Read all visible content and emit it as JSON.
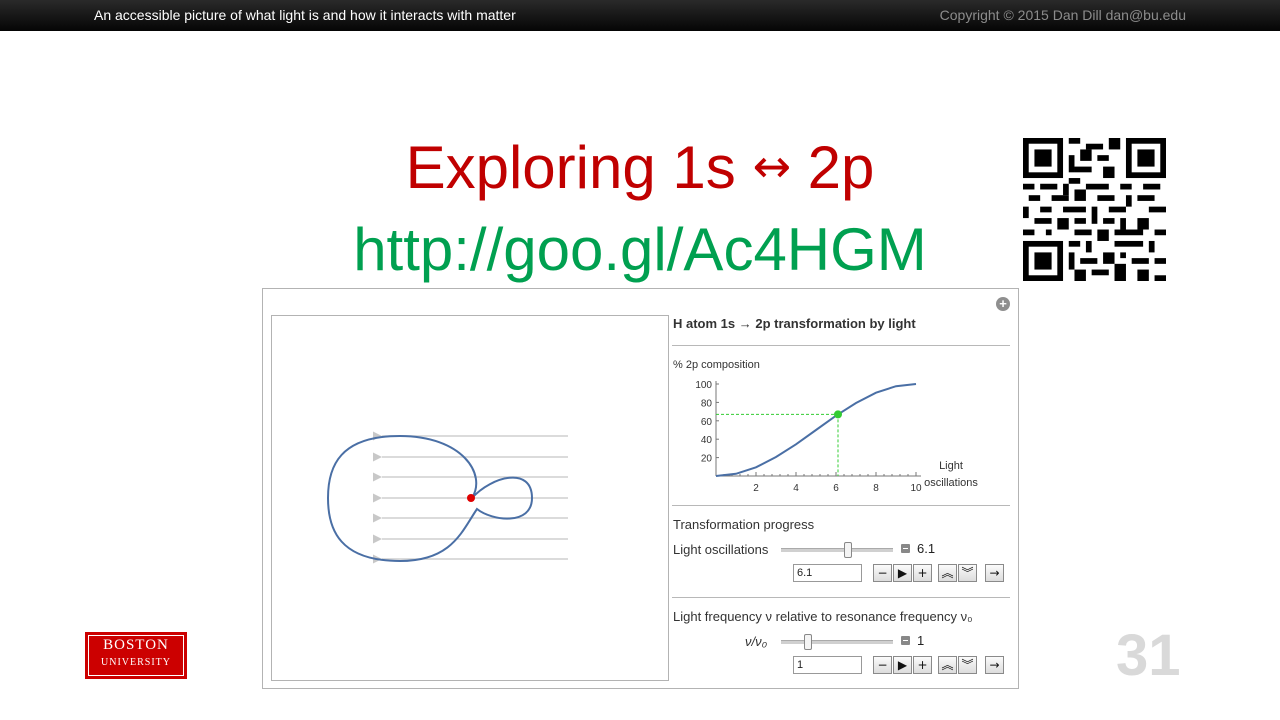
{
  "header": {
    "left_text": "An accessible picture of what light is and how it interacts with matter",
    "right_text": "Copyright © 2015 Dan Dill dan@bu.edu"
  },
  "slide": {
    "title_prefix": "Exploring 1s",
    "title_arrow": "↔",
    "title_suffix": "2p",
    "link": "http://goo.gl/Ac4HGM",
    "page_number": "31"
  },
  "logo": {
    "line1": "BOSTON",
    "line2": "UNIVERSITY"
  },
  "panel": {
    "plus_icon": "+",
    "title": "H atom 1s → 2p transformation by light",
    "graph": {
      "ylabel": "% 2p composition",
      "xlabel_line1": "Light",
      "xlabel_line2": "oscillations",
      "y_ticks": [
        "100",
        "80",
        "60",
        "40",
        "20"
      ],
      "x_ticks": [
        "2",
        "4",
        "6",
        "8",
        "10"
      ]
    },
    "progress": {
      "section_label": "Transformation progress",
      "label": "Light oscillations",
      "value": "6.1",
      "input_value": "6.1",
      "slider_fraction": 0.61
    },
    "frequency": {
      "section_label": "Light frequency ν relative to resonance frequency ν₀",
      "label": "ν/ν₀",
      "value": "1",
      "input_value": "1",
      "slider_fraction": 0.22
    },
    "buttons": {
      "minus": "−",
      "play": "▶",
      "plus": "+",
      "faster": "︽",
      "slower": "︾",
      "direction": "→"
    }
  },
  "chart_data": {
    "type": "line",
    "xlabel": "Light oscillations",
    "ylabel": "% 2p composition",
    "xlim": [
      0,
      10
    ],
    "ylim": [
      0,
      100
    ],
    "x_ticks": [
      2,
      4,
      6,
      8,
      10
    ],
    "y_ticks": [
      20,
      40,
      60,
      80,
      100
    ],
    "series": [
      {
        "values": [
          {
            "x": 0,
            "y": 0
          },
          {
            "x": 1,
            "y": 2.4
          },
          {
            "x": 2,
            "y": 9.5
          },
          {
            "x": 3,
            "y": 20.6
          },
          {
            "x": 4,
            "y": 34.5
          },
          {
            "x": 5,
            "y": 50
          },
          {
            "x": 6,
            "y": 65.5
          },
          {
            "x": 7,
            "y": 79.4
          },
          {
            "x": 8,
            "y": 90.5
          },
          {
            "x": 9,
            "y": 97.6
          },
          {
            "x": 10,
            "y": 100
          }
        ]
      }
    ],
    "marker": {
      "x": 6.1,
      "y": 67
    }
  },
  "colors": {
    "title": "#c00000",
    "link": "#00a050",
    "curve": "#4a6fa5",
    "marker": "#33cc33",
    "nucleus": "#e00000",
    "logo": "#cc0000"
  }
}
